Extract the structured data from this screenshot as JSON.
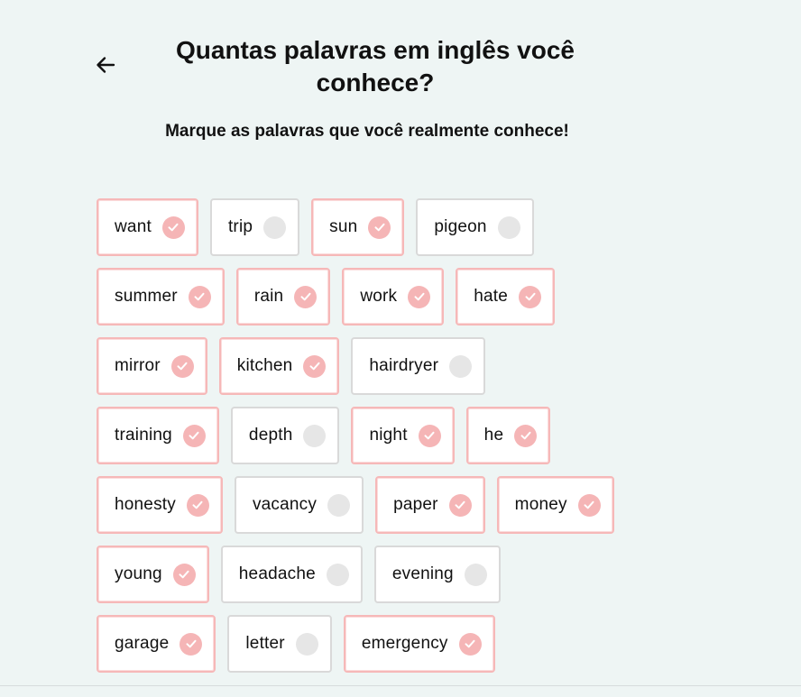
{
  "header": {
    "back_icon": "arrow-left-icon",
    "title": "Quantas palavras em inglês você conhece?",
    "subtitle": "Marque as palavras que você realmente conhece!"
  },
  "colors": {
    "background": "#eef5f4",
    "selected_border": "#f6b8b8",
    "selected_check": "#f5b5b6",
    "unselected_border": "#d9d9d9",
    "unselected_mark": "#e6e6e6"
  },
  "word_rows": [
    [
      {
        "word": "want",
        "checked": true
      },
      {
        "word": "trip",
        "checked": false
      },
      {
        "word": "sun",
        "checked": true
      },
      {
        "word": "pigeon",
        "checked": false
      }
    ],
    [
      {
        "word": "summer",
        "checked": true
      },
      {
        "word": "rain",
        "checked": true
      },
      {
        "word": "work",
        "checked": true
      },
      {
        "word": "hate",
        "checked": true
      }
    ],
    [
      {
        "word": "mirror",
        "checked": true
      },
      {
        "word": "kitchen",
        "checked": true
      },
      {
        "word": "hairdryer",
        "checked": false
      }
    ],
    [
      {
        "word": "training",
        "checked": true
      },
      {
        "word": "depth",
        "checked": false
      },
      {
        "word": "night",
        "checked": true
      },
      {
        "word": "he",
        "checked": true
      }
    ],
    [
      {
        "word": "honesty",
        "checked": true
      },
      {
        "word": "vacancy",
        "checked": false
      },
      {
        "word": "paper",
        "checked": true
      },
      {
        "word": "money",
        "checked": true
      }
    ],
    [
      {
        "word": "young",
        "checked": true
      },
      {
        "word": "headache",
        "checked": false
      },
      {
        "word": "evening",
        "checked": false
      }
    ],
    [
      {
        "word": "garage",
        "checked": true
      },
      {
        "word": "letter",
        "checked": false
      },
      {
        "word": "emergency",
        "checked": true
      }
    ]
  ]
}
